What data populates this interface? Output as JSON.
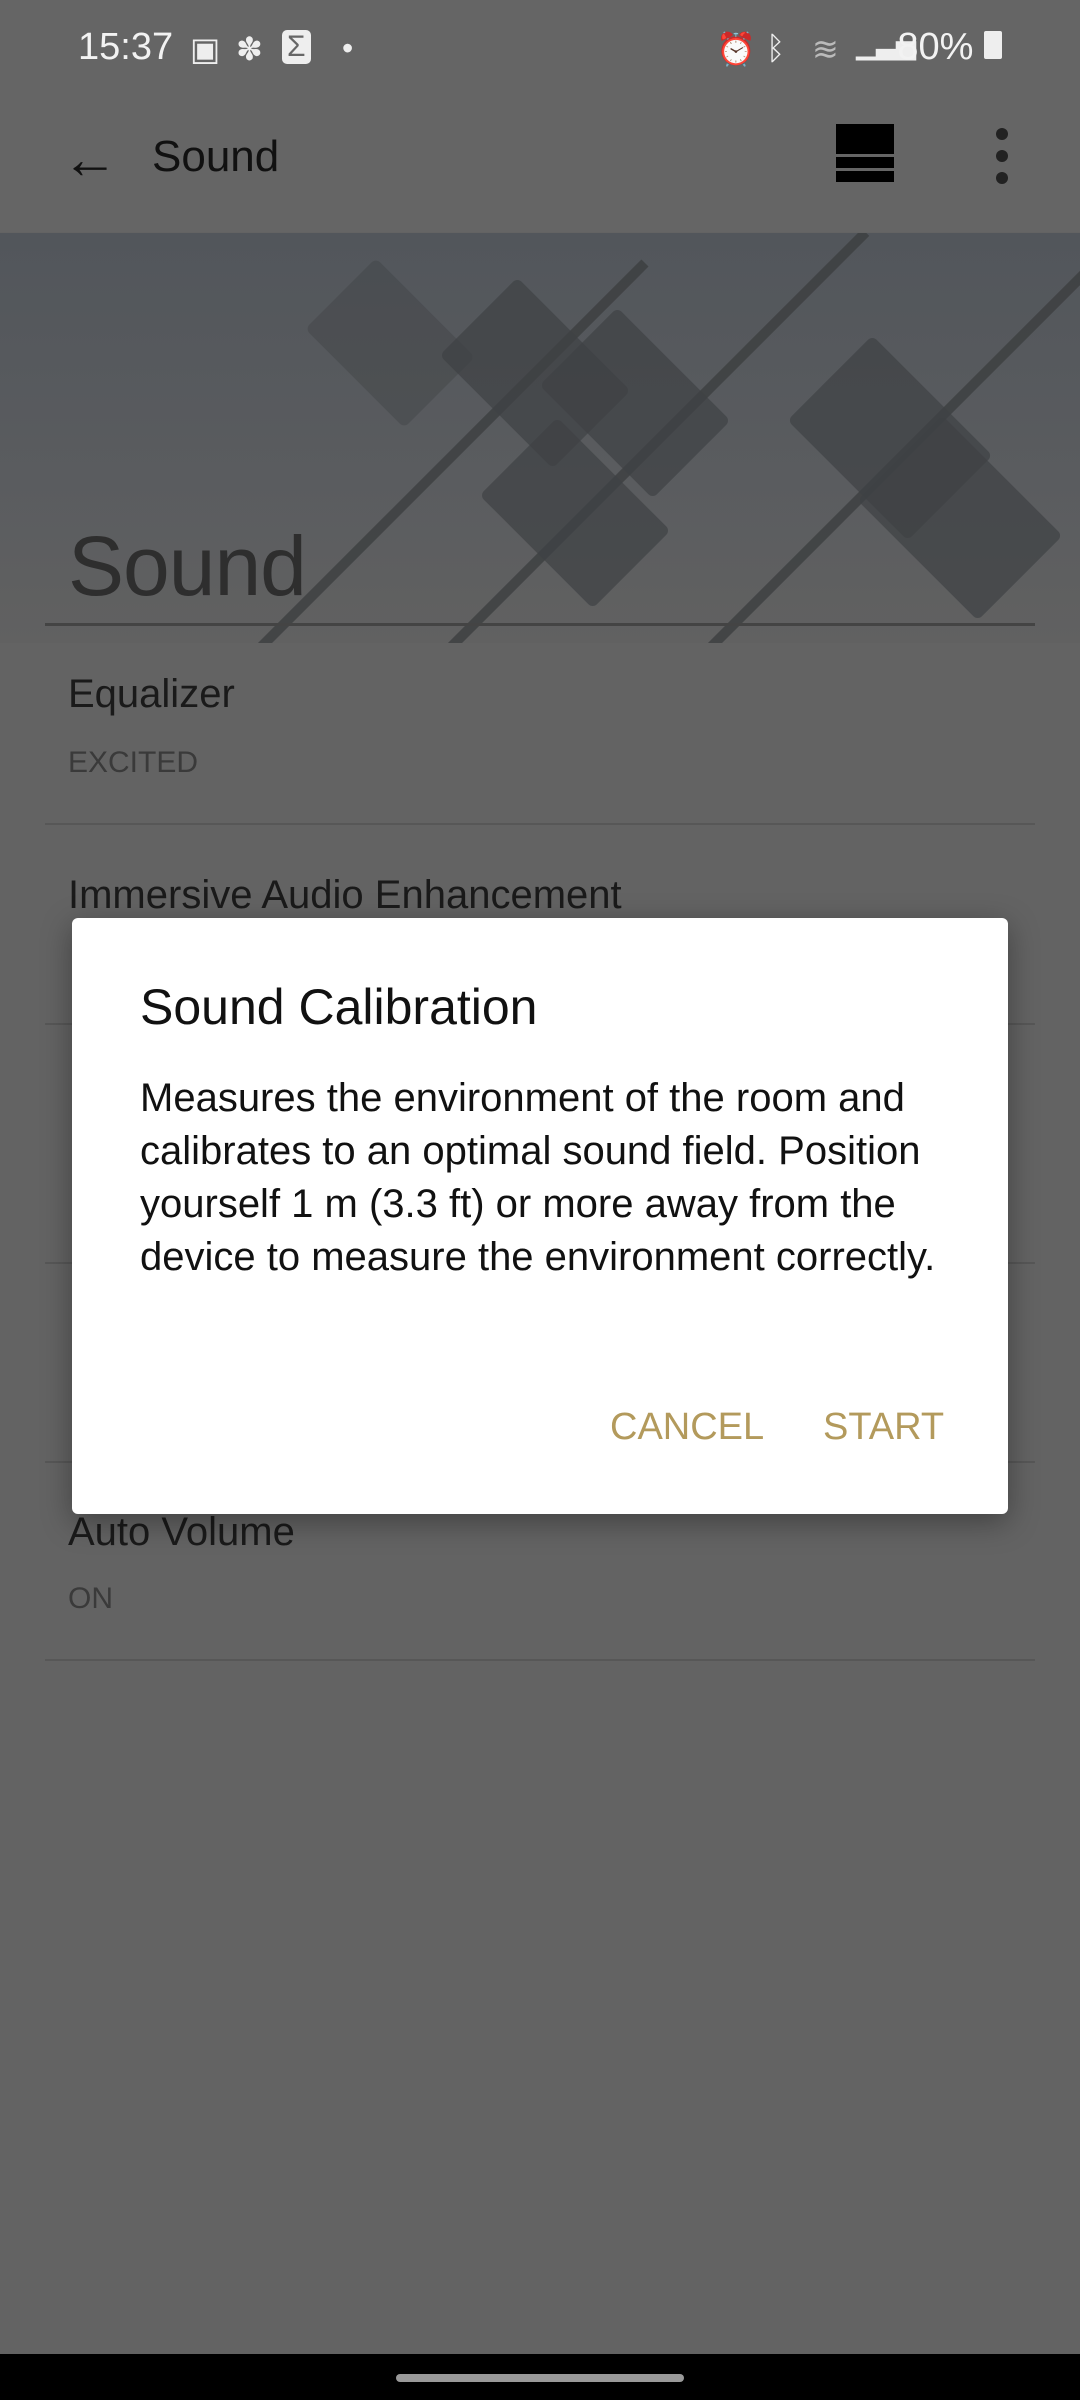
{
  "status_bar": {
    "time": "15:37",
    "left_icons": [
      "gallery-icon",
      "network-icon",
      "sigma-app-icon",
      "dot-icon"
    ],
    "right_icons": [
      "alarm-icon",
      "bluetooth-icon",
      "wifi-icon",
      "signal-icon"
    ],
    "battery": "80%"
  },
  "toolbar": {
    "title": "Sound",
    "back_icon": "arrow-left-icon",
    "layout_icon": "layout-icon",
    "more_icon": "more-vert-icon"
  },
  "header": {
    "title": "Sound"
  },
  "settings": [
    {
      "title": "Equalizer",
      "value": "EXCITED"
    },
    {
      "title": "Immersive Audio Enhancement"
    },
    {
      "title": "Auto Volume",
      "value": "ON"
    }
  ],
  "dialog": {
    "title": "Sound Calibration",
    "body": "Measures the environment of the room and calibrates to an optimal sound field. Position yourself 1 m (3.3 ft) or more away from the device to measure the environment correctly.",
    "cancel": "CANCEL",
    "start": "START"
  },
  "colors": {
    "accent": "#b39a5c",
    "scrim": "#636363"
  }
}
